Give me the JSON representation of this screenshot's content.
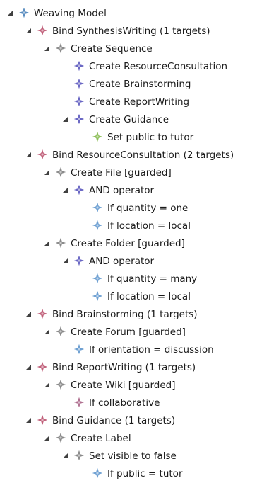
{
  "tree": {
    "nodes": [
      {
        "label": "Weaving Model",
        "level": 0,
        "expandable": true,
        "icon": "weaving-model-icon",
        "color": "#5b8ec0"
      },
      {
        "label": "Bind SynthesisWriting (1 targets)",
        "level": 1,
        "expandable": true,
        "icon": "bind-icon",
        "color": "#c0607a"
      },
      {
        "label": "Create Sequence",
        "level": 2,
        "expandable": true,
        "icon": "create-icon",
        "color": "#8a8a8a"
      },
      {
        "label": "Create ResourceConsultation",
        "level": 3,
        "expandable": false,
        "icon": "create-activity-icon",
        "color": "#6a67c4"
      },
      {
        "label": "Create Brainstorming",
        "level": 3,
        "expandable": false,
        "icon": "create-activity-icon",
        "color": "#6a67c4"
      },
      {
        "label": "Create ReportWriting",
        "level": 3,
        "expandable": false,
        "icon": "create-activity-icon",
        "color": "#6a67c4"
      },
      {
        "label": "Create Guidance",
        "level": 3,
        "expandable": true,
        "icon": "create-activity-icon",
        "color": "#6a67c4"
      },
      {
        "label": "Set public to tutor",
        "level": 4,
        "expandable": false,
        "icon": "set-icon",
        "color": "#8dbf5a"
      },
      {
        "label": "Bind ResourceConsultation (2 targets)",
        "level": 1,
        "expandable": true,
        "icon": "bind-icon",
        "color": "#c0607a"
      },
      {
        "label": "Create File [guarded]",
        "level": 2,
        "expandable": true,
        "icon": "create-icon",
        "color": "#8a8a8a"
      },
      {
        "label": "AND operator",
        "level": 3,
        "expandable": true,
        "icon": "operator-icon",
        "color": "#6a67c4"
      },
      {
        "label": "If quantity = one",
        "level": 4,
        "expandable": false,
        "icon": "condition-icon",
        "color": "#6ea0d2"
      },
      {
        "label": "If location = local",
        "level": 4,
        "expandable": false,
        "icon": "condition-icon",
        "color": "#6ea0d2"
      },
      {
        "label": "Create Folder [guarded]",
        "level": 2,
        "expandable": true,
        "icon": "create-icon",
        "color": "#8a8a8a"
      },
      {
        "label": "AND operator",
        "level": 3,
        "expandable": true,
        "icon": "operator-icon",
        "color": "#6a67c4"
      },
      {
        "label": "If quantity = many",
        "level": 4,
        "expandable": false,
        "icon": "condition-icon",
        "color": "#6ea0d2"
      },
      {
        "label": "If location = local",
        "level": 4,
        "expandable": false,
        "icon": "condition-icon",
        "color": "#6ea0d2"
      },
      {
        "label": "Bind Brainstorming (1 targets)",
        "level": 1,
        "expandable": true,
        "icon": "bind-icon",
        "color": "#c0607a"
      },
      {
        "label": "Create Forum [guarded]",
        "level": 2,
        "expandable": true,
        "icon": "create-icon",
        "color": "#8a8a8a"
      },
      {
        "label": "If orientation = discussion",
        "level": 3,
        "expandable": false,
        "icon": "condition-icon",
        "color": "#6ea0d2"
      },
      {
        "label": "Bind ReportWriting (1 targets)",
        "level": 1,
        "expandable": true,
        "icon": "bind-icon",
        "color": "#c0607a"
      },
      {
        "label": "Create Wiki [guarded]",
        "level": 2,
        "expandable": true,
        "icon": "create-icon",
        "color": "#8a8a8a"
      },
      {
        "label": "If collaborative",
        "level": 3,
        "expandable": false,
        "icon": "condition-icon",
        "color": "#b07090"
      },
      {
        "label": "Bind Guidance (1 targets)",
        "level": 1,
        "expandable": true,
        "icon": "bind-icon",
        "color": "#c0607a"
      },
      {
        "label": "Create Label",
        "level": 2,
        "expandable": true,
        "icon": "create-icon",
        "color": "#8a8a8a"
      },
      {
        "label": "Set visible to false",
        "level": 3,
        "expandable": true,
        "icon": "set-icon",
        "color": "#8a8a8a"
      },
      {
        "label": "If public = tutor",
        "level": 4,
        "expandable": false,
        "icon": "condition-icon",
        "color": "#6ea0d2"
      }
    ]
  }
}
